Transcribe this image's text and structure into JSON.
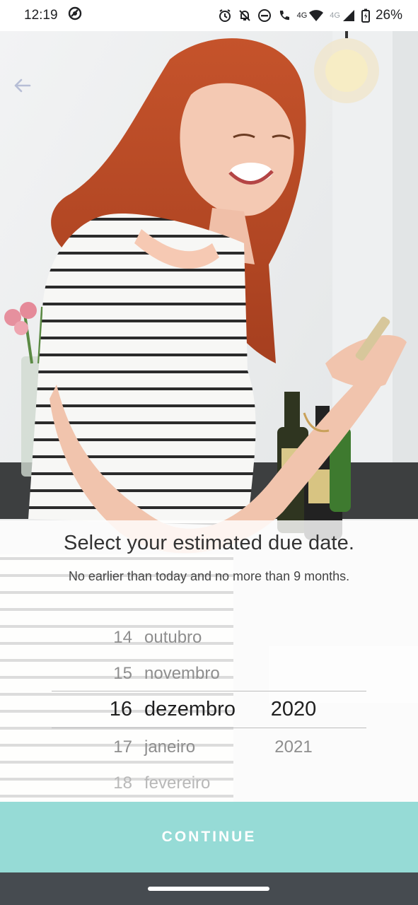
{
  "status_bar": {
    "time": "12:19",
    "network_primary": "4G",
    "network_secondary": "4G",
    "battery": "26%"
  },
  "icons": {
    "back": "arrow-left-icon",
    "sync": "sync-icon",
    "alarm": "alarm-icon",
    "mute": "notifications-off-icon",
    "dnd": "do-not-disturb-icon",
    "call": "volte-call-icon",
    "wifi": "wifi-icon",
    "signal": "signal-icon",
    "battery": "battery-charging-icon"
  },
  "sheet": {
    "title": "Select your estimated due date.",
    "subtitle": "No earlier than today and no more than 9 months."
  },
  "picker": {
    "days": [
      "14",
      "15",
      "16",
      "17",
      "18"
    ],
    "months": [
      "outubro",
      "novembro",
      "dezembro",
      "janeiro",
      "fevereiro"
    ],
    "years": [
      "2020",
      "2021"
    ],
    "selected_day": "16",
    "selected_month": "dezembro",
    "selected_year": "2020"
  },
  "continue_label": "CONTINUE",
  "colors": {
    "accent": "#96dbd6",
    "nav_bar": "#464b50",
    "back_arrow": "#b7bed6"
  }
}
